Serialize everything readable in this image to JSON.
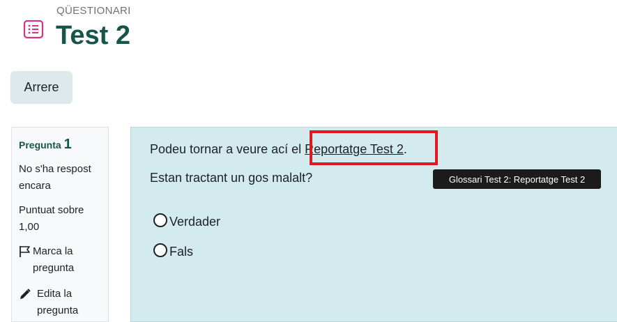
{
  "header": {
    "activity_type": "QÜESTIONARI",
    "title": "Test 2",
    "activity_icon": "quiz-list-icon",
    "accent_color": "#d63384"
  },
  "navigation": {
    "back_label": "Arrere"
  },
  "question_info": {
    "heading_label": "Pregunta",
    "number": "1",
    "status": "No s'ha respost encara",
    "mark": "Puntuat sobre 1,00",
    "flag_label": "Marca la pregunta",
    "flag_icon": "flag-icon",
    "edit_label": "Edita la pregunta",
    "edit_icon": "pencil-icon"
  },
  "question": {
    "intro_prefix": "Podeu tornar a veure ací el ",
    "link_text": "Reportatge Test 2",
    "intro_suffix": ".",
    "text": "Estan tractant un gos malalt?",
    "options": [
      "Verdader",
      "Fals"
    ]
  },
  "tooltip": {
    "text": "Glossari Test 2: Reportatge Test 2"
  }
}
